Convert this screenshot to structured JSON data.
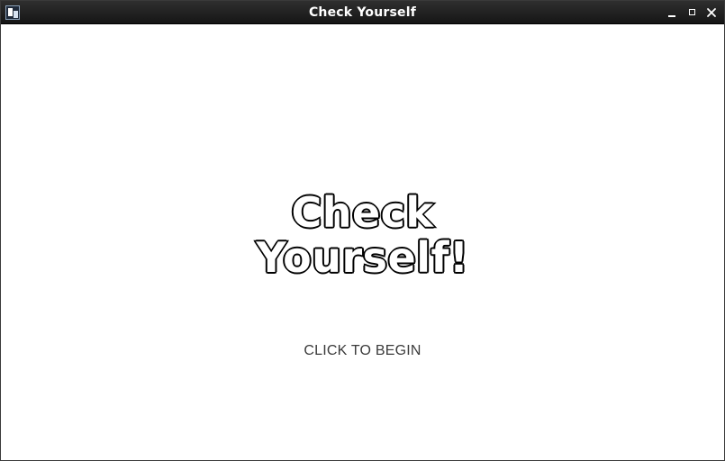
{
  "window": {
    "title": "Check Yourself"
  },
  "splash": {
    "logo_line1": "Check",
    "logo_line2": "Yourself!",
    "cta_label": "CLICK TO BEGIN"
  },
  "icons": {
    "app": "app-icon",
    "minimize": "minimize-icon",
    "maximize": "maximize-icon",
    "close": "close-icon"
  }
}
